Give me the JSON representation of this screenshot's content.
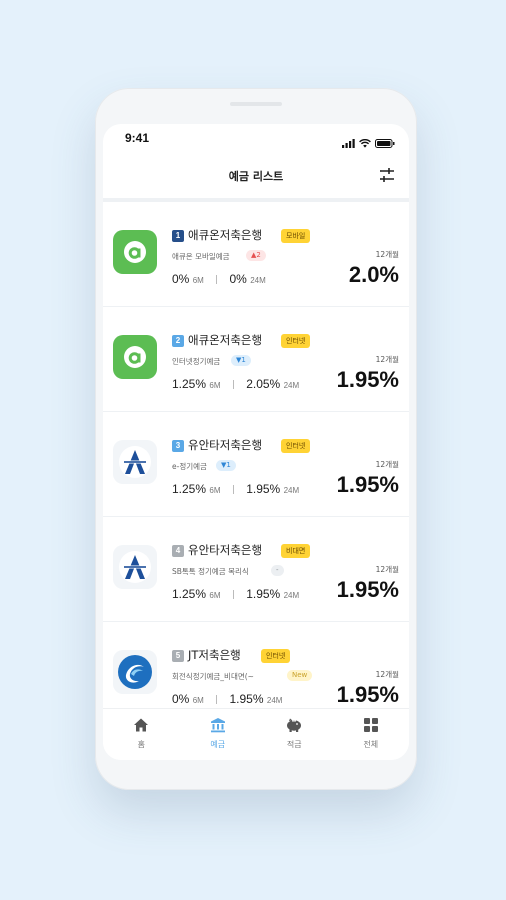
{
  "status_bar": {
    "time": "9:41"
  },
  "header": {
    "title": "예금 리스트",
    "filter_icon": "sliders-icon"
  },
  "colors": {
    "accent": "#5aa8e6",
    "tag_yellow": "#ffd335",
    "rank_navy": "#264f8a",
    "rank_blue": "#5aa8e6",
    "rank_gray": "#a9aeb3"
  },
  "deposits": [
    {
      "rank": "1",
      "bank": "애큐온저축은행",
      "tag": "모바일",
      "product": "애큐온 모바일예금",
      "chip": "▲2",
      "rate_6m": "0%",
      "rate_6m_unit": "6M",
      "rate_24m": "0%",
      "rate_24m_unit": "24M",
      "term": "12개월",
      "rate": "2.0%",
      "logo": "acuon-logo-icon"
    },
    {
      "rank": "2",
      "bank": "애큐온저축은행",
      "tag": "인터넷",
      "product": "인터넷정기예금",
      "chip": "▼1",
      "rate_6m": "1.25%",
      "rate_6m_unit": "6M",
      "rate_24m": "2.05%",
      "rate_24m_unit": "24M",
      "term": "12개월",
      "rate": "1.95%",
      "logo": "acuon-logo-icon"
    },
    {
      "rank": "3",
      "bank": "유안타저축은행",
      "tag": "인터넷",
      "product": "e-정기예금",
      "chip": "▼1",
      "rate_6m": "1.25%",
      "rate_6m_unit": "6M",
      "rate_24m": "1.95%",
      "rate_24m_unit": "24M",
      "term": "12개월",
      "rate": "1.95%",
      "logo": "yuanta-logo-icon"
    },
    {
      "rank": "4",
      "bank": "유안타저축은행",
      "tag": "비대면",
      "product": "SB톡톡 정기예금 복리식",
      "chip": "-",
      "rate_6m": "1.25%",
      "rate_6m_unit": "6M",
      "rate_24m": "1.95%",
      "rate_24m_unit": "24M",
      "term": "12개월",
      "rate": "1.95%",
      "logo": "yuanta-logo-icon"
    },
    {
      "rank": "5",
      "bank": "JT저축은행",
      "tag": "인터넷",
      "product": "회전식정기예금_비대면(~",
      "chip": "New",
      "rate_6m": "0%",
      "rate_6m_unit": "6M",
      "rate_24m": "1.95%",
      "rate_24m_unit": "24M",
      "term": "12개월",
      "rate": "1.95%",
      "logo": "jt-logo-icon"
    }
  ],
  "tabbar": {
    "items": [
      {
        "label": "홈",
        "icon": "home-icon",
        "active": false
      },
      {
        "label": "예금",
        "icon": "bank-icon",
        "active": true
      },
      {
        "label": "적금",
        "icon": "piggy-bank-icon",
        "active": false
      },
      {
        "label": "전체",
        "icon": "grid-icon",
        "active": false
      }
    ]
  }
}
